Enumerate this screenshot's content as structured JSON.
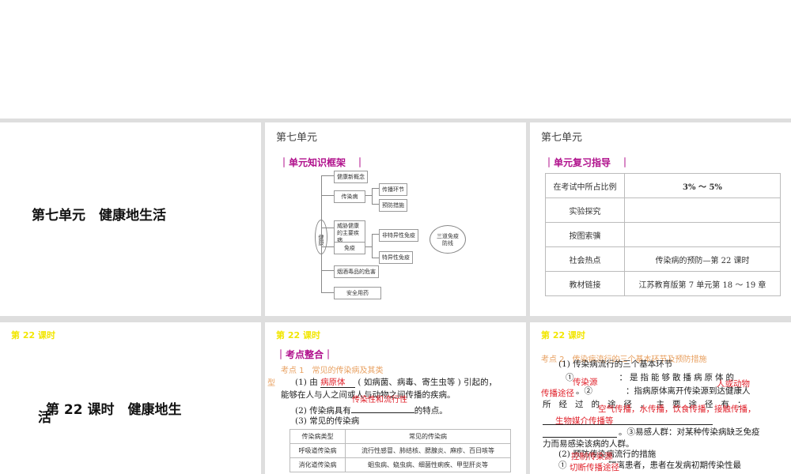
{
  "slide1": {
    "title": "第七单元　健康地生活"
  },
  "slide2": {
    "unit": "第七单元",
    "section": "｜单元知识框架　｜",
    "center": "健康",
    "boxes": [
      "健康新概念",
      "传染病",
      "威胁健康的主要疾病",
      "免疫",
      "烟酒毒品的危害",
      "安全用药"
    ],
    "sub_infect": [
      "传播环节",
      "预防措施"
    ],
    "sub_immune": [
      "非特异性免疫",
      "特异性免疫"
    ],
    "bubble": "三道免疫防线"
  },
  "slide3": {
    "unit": "第七单元",
    "section": "｜单元复习指导　｜",
    "rows": [
      [
        "在考试中所占比例",
        "3% ～ 5%"
      ],
      [
        "实验探究",
        ""
      ],
      [
        "按图索骥",
        ""
      ],
      [
        "社会热点",
        "传染病的预防—第 22 课时"
      ],
      [
        "教材链接",
        "江苏教育版第 7 单元第 18 ～ 19 章"
      ]
    ]
  },
  "slide4": {
    "lesson": "第 22 课时",
    "title": "第 22 课时　健康地生",
    "title_wrap": "活"
  },
  "slide5": {
    "lesson": "第 22 课时",
    "section": "｜考点整合｜",
    "kaodian": "考点 1　常见的传染病及其类",
    "kaodian_wrap": "型",
    "p1a": "(1) 由",
    "p1ans": "病原体",
    "p1b": "( 如病菌、病毒、寄生虫等 ) 引起的，",
    "p1c": "能够在人与人之间或人与动物之间传播的疾病。",
    "p2a": "(2) 传染病具有",
    "p2ans": "传染性和流行性",
    "p2b": "的特点。",
    "p3": "(3) 常见的传染病",
    "table": {
      "headers": [
        "传染病类型",
        "常见的传染病"
      ],
      "rows": [
        [
          "呼吸道传染病",
          "流行性感冒、肺结核、腮腺炎、麻疹、百日咳等"
        ],
        [
          "消化道传染病",
          "蛔虫病、蛲虫病、细菌性痢疾、甲型肝炎等"
        ]
      ]
    }
  },
  "slide6": {
    "lesson": "第 22 课时",
    "kaodian": "考点 2　传染病流行的三个基本环节及预防措施",
    "h1": "(1) 传染病流行的三个基本环节",
    "l1": "①　　　　：是指能够散播病原体的",
    "a1": "传染源",
    "a1b": "人或动物",
    "l2": "。②　　　　：指病原体离开传染源到达健康人",
    "a2": "传播途径",
    "l3": "所经过的途径，主要途径有：",
    "a3": "空气传播，水传播，饮食传播，接触传播，",
    "a3b": "生物媒介传播等",
    "l4": "。③易感人群：对某种传染病缺乏免疫",
    "l5": "力而易感染该病的人群。",
    "h2": "(2) 预防传染病流行的措施",
    "a4": "控制传染源",
    "l6": "①　　　　：隔离患者，患者在发病初期传染性最",
    "a5": "切断传播途径"
  }
}
